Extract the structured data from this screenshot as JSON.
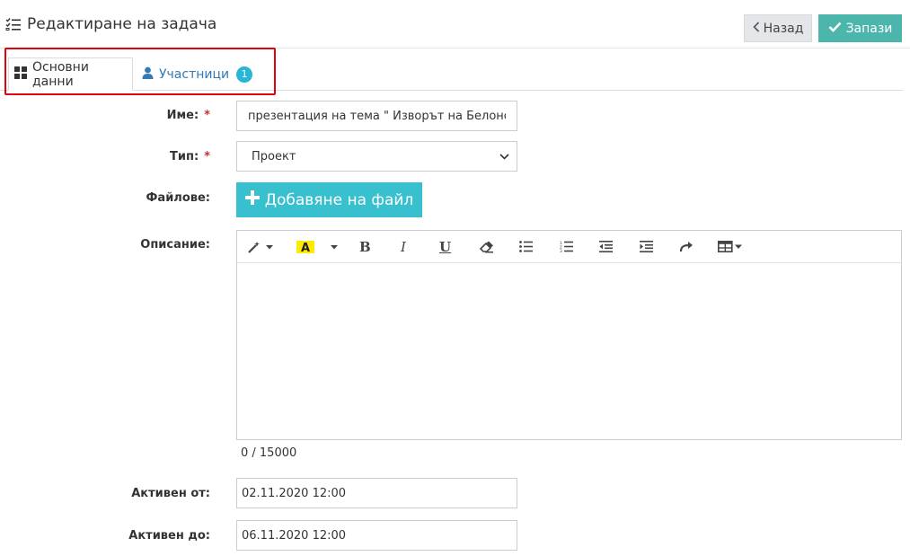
{
  "header": {
    "title": "Редактиране на задача",
    "back_label": "Назад",
    "save_label": "Запази"
  },
  "tabs": [
    {
      "label": "Основни данни",
      "active": true
    },
    {
      "label": "Участници",
      "badge": "1",
      "active": false
    }
  ],
  "form": {
    "name": {
      "label": "Име:",
      "required": "*",
      "value": "презентация на тема \" Изворът на Белонс"
    },
    "type": {
      "label": "Тип:",
      "required": "*",
      "value": "Проект"
    },
    "files": {
      "label": "Файлове:",
      "button_label": "Добавяне на файл"
    },
    "description": {
      "label": "Описание:",
      "counter": "0 / 15000"
    },
    "active_from": {
      "label": "Активен от:",
      "value": "02.11.2020 12:00"
    },
    "active_to": {
      "label": "Активен до:",
      "value": "06.11.2020 12:00"
    }
  },
  "editor_toolbar": [
    "magic-wand-icon",
    "text-highlight-icon",
    "bold-icon",
    "italic-icon",
    "underline-icon",
    "eraser-icon",
    "unordered-list-icon",
    "ordered-list-icon",
    "outdent-icon",
    "indent-icon",
    "redo-icon",
    "table-icon"
  ],
  "colors": {
    "save": "#4db6ac",
    "file_button": "#39c0cf",
    "badge": "#29b6d6",
    "highlight_border": "#e3000f",
    "link": "#337ab7"
  }
}
